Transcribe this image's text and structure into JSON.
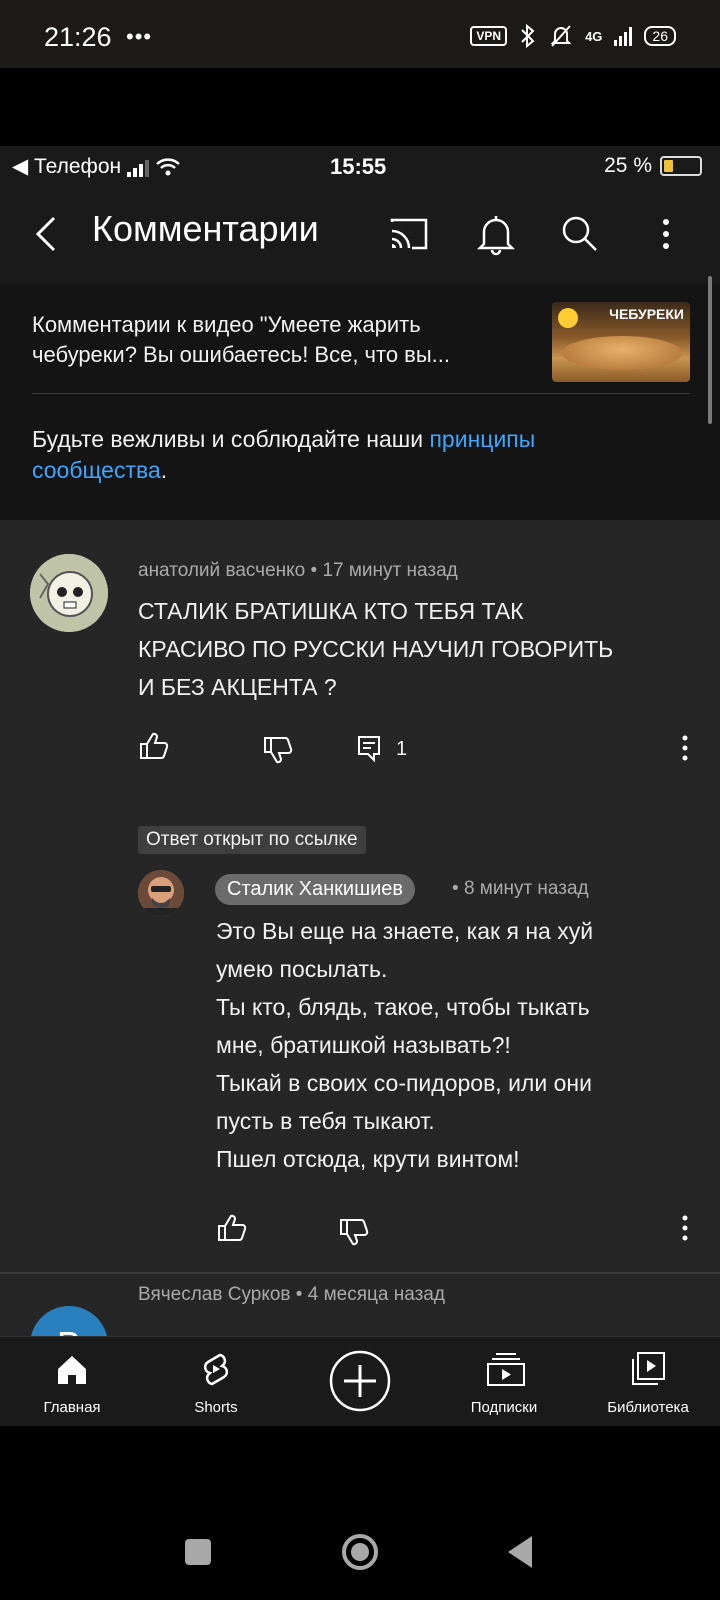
{
  "android_status": {
    "time": "21:26",
    "dots": "•••",
    "vpn": "VPN",
    "network": "4G",
    "battery": "26"
  },
  "ios_status": {
    "carrier": "◀ Телефон",
    "time": "15:55",
    "battery_text": "25 %",
    "battery_level": 0.25
  },
  "header": {
    "title": "Комментарии",
    "icons": [
      "back-icon",
      "cast-icon",
      "bell-icon",
      "search-icon",
      "more-icon"
    ]
  },
  "info": {
    "video_caption": "Комментарии к видео \"Умеете жарить чебуреки? Вы ошибаетесь! Все, что вы...",
    "thumbnail_label": "ЧЕБУРЕКИ",
    "rules_text": "Будьте вежливы и соблюдайте наши ",
    "rules_link": "принципы сообщества",
    "rules_end": "."
  },
  "comments": [
    {
      "author": "анатолий васченко",
      "sep": "•",
      "time": "17 минут назад",
      "line1": "СТАЛИК БРАТИШКА КТО ТЕБЯ ТАК",
      "line2": "КРАСИВО ПО РУССКИ НАУЧИЛ ГОВОРИТЬ",
      "line3": "И БЕЗ АКЦЕНТА ?",
      "reply_count": "1"
    },
    {
      "badge": "Ответ открыт по ссылке",
      "author": "Сталик Ханкишиев",
      "sep": "•",
      "time": "8 минут назад",
      "lines": [
        "Это Вы еще на знаете, как я на хуй",
        "умею посылать.",
        "Ты кто, блядь, такое, чтобы тыкать",
        "мне, братишкой называть?!",
        "Тыкай в своих со-пидоров, или они",
        "пусть в тебя тыкают.",
        "Пшел отсюда, крути винтом!"
      ]
    },
    {
      "author": "Вячеслав Сурков",
      "sep": "•",
      "time": "4 месяца назад",
      "avatar_letter": "В"
    }
  ],
  "nav": {
    "home": "Главная",
    "shorts": "Shorts",
    "subs": "Подписки",
    "library": "Библиотека"
  },
  "colors": {
    "link": "#3ea6ff",
    "background": "#262626",
    "header": "#1a1a1a"
  }
}
